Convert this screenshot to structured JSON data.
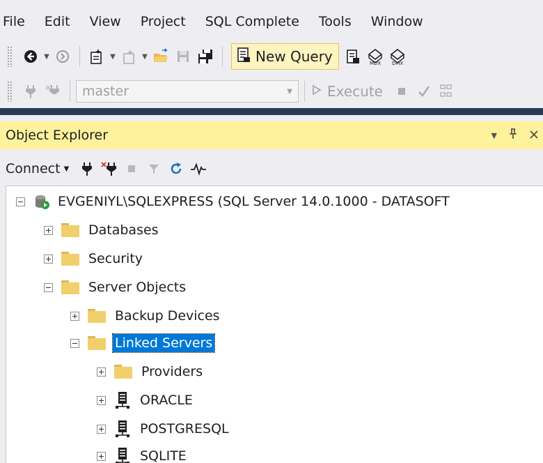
{
  "menu": [
    "File",
    "Edit",
    "View",
    "Project",
    "SQL Complete",
    "Tools",
    "Window"
  ],
  "toolbar": {
    "new_query_label": "New Query"
  },
  "toolbar2": {
    "database": "master",
    "execute_label": "Execute"
  },
  "object_explorer": {
    "title": "Object Explorer",
    "connect_label": "Connect",
    "server_node": "EVGENIYL\\SQLEXPRESS (SQL Server 14.0.1000 - DATASOFT",
    "nodes": {
      "databases": "Databases",
      "security": "Security",
      "server_objects": "Server Objects",
      "backup_devices": "Backup Devices",
      "linked_servers": "Linked Servers",
      "providers": "Providers",
      "oracle": "ORACLE",
      "postgresql": "POSTGRESQL",
      "sqlite": "SQLITE"
    }
  },
  "colors": {
    "selection": "#0078d7",
    "panel_title_bg": "#fff29d",
    "dark_line": "#293955",
    "folder": "#f1cf6d"
  }
}
